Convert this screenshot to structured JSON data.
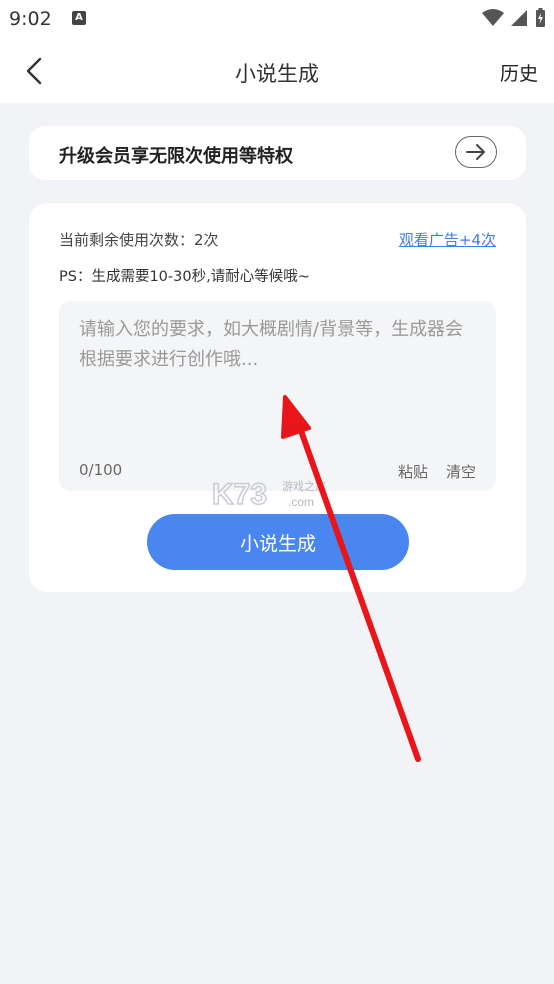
{
  "status_bar": {
    "time": "9:02",
    "notification_icon": "A"
  },
  "nav": {
    "title": "小说生成",
    "history_label": "历史"
  },
  "vip": {
    "text": "升级会员享无限次使用等特权"
  },
  "main": {
    "remaining_text": "当前剩余使用次数：2次",
    "watch_ad_label": "观看广告+4次",
    "ps_text": "PS：生成需要10-30秒,请耐心等候哦~",
    "input": {
      "value": "",
      "placeholder": "请输入您的要求，如大概剧情/背景等，生成器会根据要求进行创作哦..."
    },
    "counter": "0/100",
    "paste_label": "粘贴",
    "clear_label": "清空",
    "generate_label": "小说生成"
  },
  "watermark": {
    "text": "K73",
    "sub_text": "游戏之家",
    "domain": ".com"
  },
  "colors": {
    "accent": "#4a86f0",
    "link": "#3f7ee8",
    "background": "#f2f3f6",
    "annotation_arrow": "#e8151b"
  }
}
